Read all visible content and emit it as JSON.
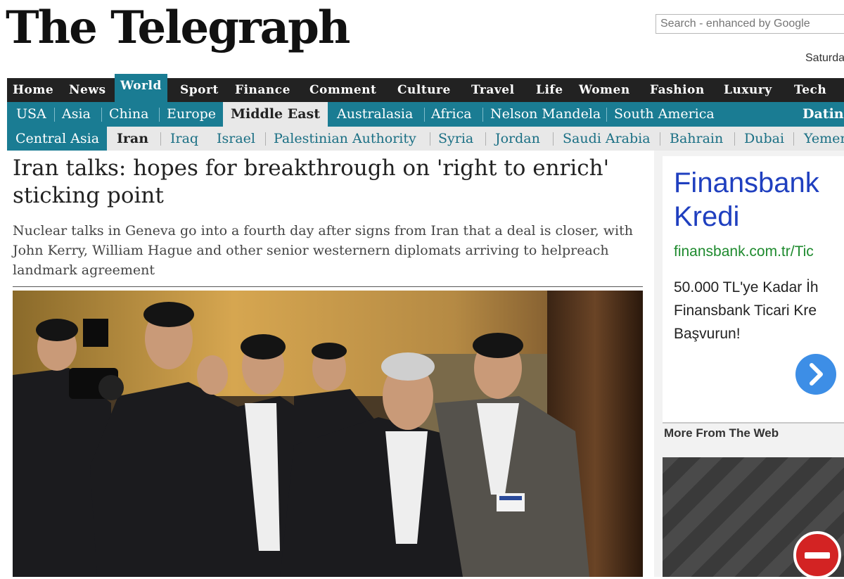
{
  "masthead": {
    "logo": "The Telegraph",
    "search_placeholder": "Search - enhanced by Google",
    "date": "Saturday"
  },
  "nav_primary": [
    "Home",
    "News",
    "World",
    "Sport",
    "Finance",
    "Comment",
    "Culture",
    "Travel",
    "Life",
    "Women",
    "Fashion",
    "Luxury",
    "Tech"
  ],
  "nav_primary_active": "World",
  "nav_secondary": [
    "USA",
    "Asia",
    "China",
    "Europe",
    "Middle East",
    "Australasia",
    "Africa",
    "Nelson Mandela",
    "South America",
    "Dating"
  ],
  "nav_secondary_active": "Middle East",
  "nav_tertiary": [
    "Central Asia",
    "Iran",
    "Iraq",
    "Israel",
    "Palestinian Authority",
    "Syria",
    "Jordan",
    "Saudi Arabia",
    "Bahrain",
    "Dubai",
    "Yemen"
  ],
  "nav_tertiary_active": "Iran",
  "article": {
    "headline": "Iran talks: hopes for breakthrough on 'right to enrich' sticking point",
    "standfirst": "Nuclear talks in Geneva go into a fourth day after signs from Iran that a deal is closer, with John Kerry, William Hague and other senior westernern diplomats arriving to helpreach landmark agreement"
  },
  "sidebar": {
    "ad": {
      "title": "Finansbank Kredi",
      "url": "finansbank.com.tr/Tic",
      "text": "50.000 TL'ye Kadar İh\nFinansbank Ticari Kre\nBaşvurun!"
    },
    "more_title": "More From The Web"
  },
  "colors": {
    "nav_primary_bg": "#222222",
    "accent_teal": "#1a7c93",
    "ad_title": "#1f3fbf",
    "ad_url": "#1e8a2e"
  }
}
